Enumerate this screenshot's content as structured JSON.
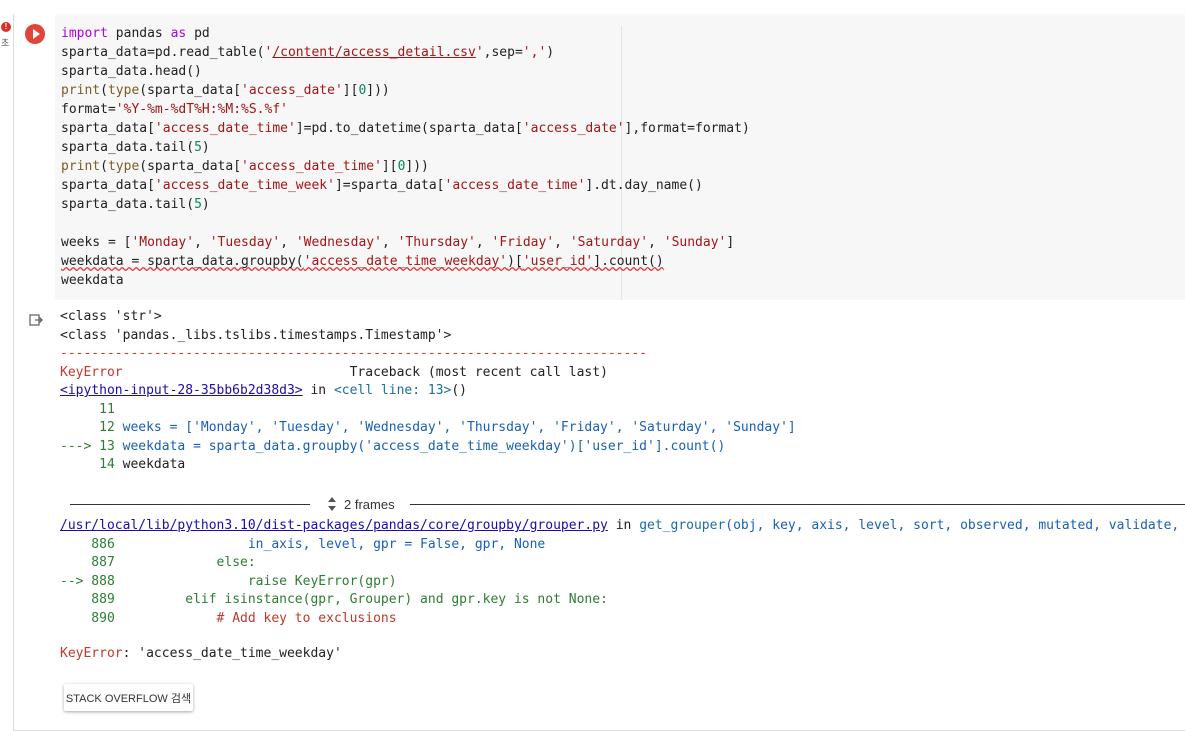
{
  "gutter": {
    "error_badge": "!",
    "error_label": "초"
  },
  "code_lines": [
    "import pandas as pd",
    "sparta_data=pd.read_table('/content/access_detail.csv',sep=',')",
    "sparta_data.head()",
    "print(type(sparta_data['access_date'][0]))",
    "format='%Y-%m-%dT%H:%M:%S.%f'",
    "sparta_data['access_date_time']=pd.to_datetime(sparta_data['access_date'],format=format)",
    "sparta_data.tail(5)",
    "print(type(sparta_data['access_date_time'][0]))",
    "sparta_data['access_date_time_week']=sparta_data['access_date_time'].dt.day_name()",
    "sparta_data.tail(5)",
    "",
    "weeks = ['Monday', 'Tuesday', 'Wednesday', 'Thursday', 'Friday', 'Saturday', 'Sunday']",
    "weekdata = sparta_data.groupby('access_date_time_weekday')['user_id'].count()",
    "weekdata"
  ],
  "output": {
    "stdout": [
      "<class 'str'>",
      "<class 'pandas._libs.tslibs.timestamps.Timestamp'>"
    ],
    "separator": "---------------------------------------------------------------------------",
    "error_name": "KeyError",
    "traceback_label": "Traceback (most recent call last)",
    "input_link": "<ipython-input-28-35bb6b2d38d3>",
    "in_text": " in ",
    "cell_ref": "<cell line: 13>",
    "cell_ref_suffix": "()",
    "context_lines": [
      {
        "prefix": "     11",
        "code": ""
      },
      {
        "prefix": "     12",
        "code": " weeks = ['Monday', 'Tuesday', 'Wednesday', 'Thursday', 'Friday', 'Saturday', 'Sunday']"
      },
      {
        "prefix": "---> 13",
        "code": " weekdata = sparta_data.groupby('access_date_time_weekday')['user_id'].count()"
      },
      {
        "prefix": "     14",
        "code": " weekdata"
      }
    ],
    "frames_label": "2 frames",
    "file_link": "/usr/local/lib/python3.10/dist-packages/pandas/core/groupby/grouper.py",
    "file_func": "get_grouper",
    "file_args": "(obj, key, axis, level, sort, observed, mutated, validate, dropna)",
    "lib_lines": [
      {
        "prefix": "    886",
        "code": "                 in_axis, level, gpr = False, gpr, None"
      },
      {
        "prefix": "    887",
        "code": "             else:"
      },
      {
        "prefix": "--> 888",
        "code": "                 raise KeyError(gpr)"
      },
      {
        "prefix": "    889",
        "code": "         elif isinstance(gpr, Grouper) and gpr.key is not None:"
      },
      {
        "prefix": "    890",
        "code": "             # Add key to exclusions"
      }
    ],
    "final_error_name": "KeyError",
    "final_error_msg": ": 'access_date_time_weekday'",
    "stack_overflow_button": "STACK OVERFLOW 검색"
  }
}
